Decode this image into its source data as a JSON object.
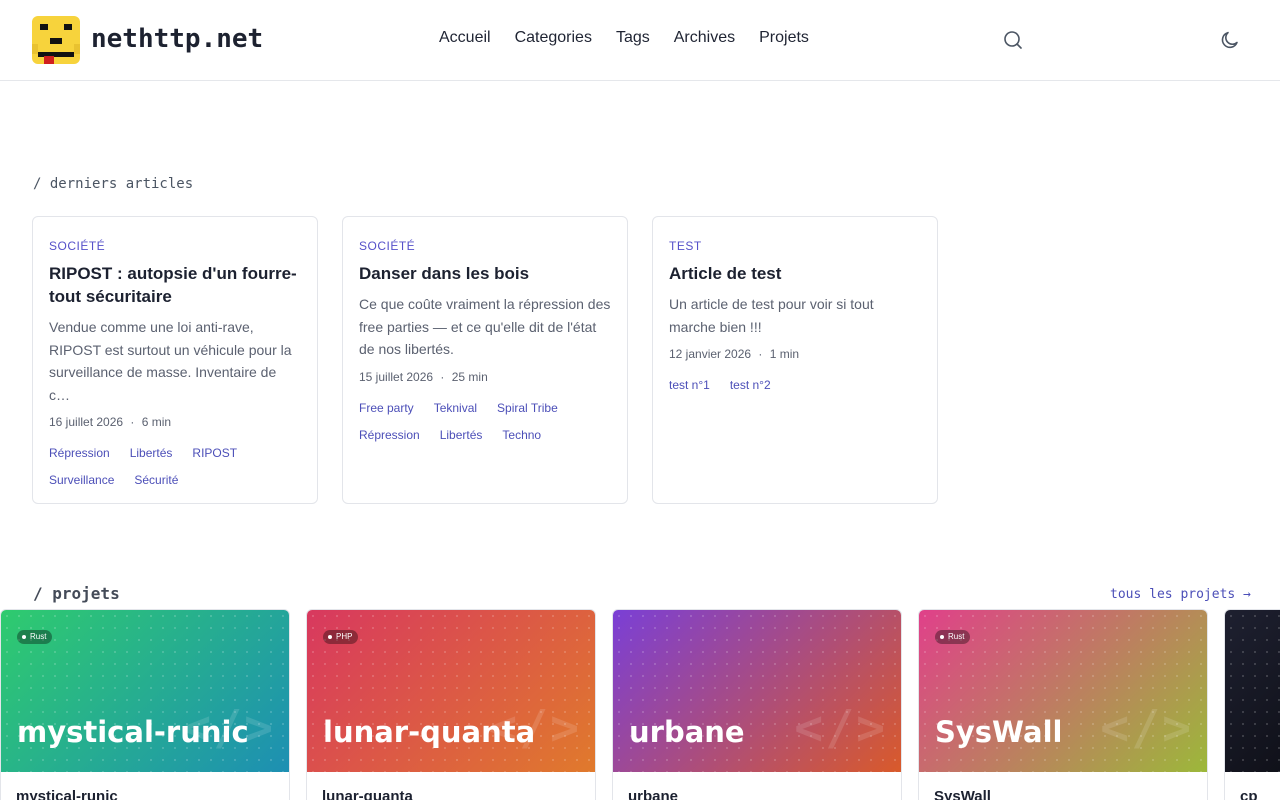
{
  "header": {
    "site_name": "nethttp.net",
    "nav": [
      "Accueil",
      "Categories",
      "Tags",
      "Archives",
      "Projets"
    ],
    "search_icon": "search-icon",
    "theme_icon": "moon-icon"
  },
  "sections": {
    "articles_title": "/ derniers articles",
    "projects_title": "/ projets",
    "all_projects_link": "tous les projets →"
  },
  "articles": [
    {
      "category": "SOCIÉTÉ",
      "title": "RIPOST : autopsie d'un fourre-tout sécuritaire",
      "excerpt": "Vendue comme une loi anti-rave, RIPOST est surtout un véhicule pour la surveillance de masse. Inventaire de c…",
      "date": "16 juillet 2026",
      "read_time": "6 min",
      "tags": [
        "Répression",
        "Libertés",
        "RIPOST",
        "Surveillance",
        "Sécurité"
      ]
    },
    {
      "category": "SOCIÉTÉ",
      "title": "Danser dans les bois",
      "excerpt": "Ce que coûte vraiment la répression des free parties — et ce qu'elle dit de l'état de nos libertés.",
      "date": "15 juillet 2026",
      "read_time": "25 min",
      "tags": [
        "Free party",
        "Teknival",
        "Spiral Tribe",
        "Répression",
        "Libertés",
        "Techno"
      ]
    },
    {
      "category": "TEST",
      "title": "Article de test",
      "excerpt": "Un article de test pour voir si tout marche bien !!!",
      "date": "12 janvier 2026",
      "read_time": "1 min",
      "tags": [
        "test n°1",
        "test n°2"
      ]
    }
  ],
  "projects": [
    {
      "banner_title": "mystical-runic",
      "lang": "Rust",
      "name": "mystical-runic",
      "colors": [
        "#2fcb6e",
        "#1d8fb3"
      ]
    },
    {
      "banner_title": "lunar-quanta",
      "lang": "PHP",
      "name": "lunar-quanta",
      "colors": [
        "#d8385f",
        "#e07a2c"
      ]
    },
    {
      "banner_title": "urbane",
      "lang": "",
      "name": "urbane",
      "colors": [
        "#7a3fd6",
        "#d95a2a"
      ]
    },
    {
      "banner_title": "SysWall",
      "lang": "Rust",
      "name": "SysWall",
      "colors": [
        "#e0408a",
        "#9cb83a"
      ]
    },
    {
      "banner_title": "",
      "lang": "",
      "name": "cp",
      "colors": [
        "#1e2030",
        "#0f1018"
      ]
    }
  ],
  "meta_separator": "·"
}
